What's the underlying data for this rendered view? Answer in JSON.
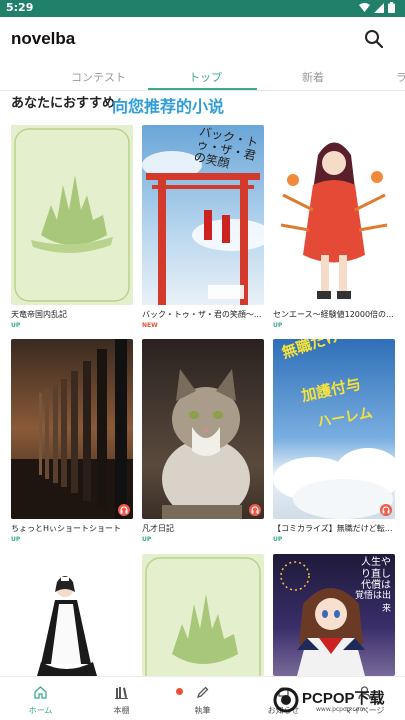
{
  "status_bar": {
    "time": "5:29"
  },
  "app_bar": {
    "title": "novelba"
  },
  "tabs": [
    {
      "label": "コンテスト"
    },
    {
      "label": "トップ"
    },
    {
      "label": "新着"
    },
    {
      "label": "ラ"
    }
  ],
  "section": {
    "title": "あなたにおすすめ",
    "overlay": "向您推荐的小说"
  },
  "books": [
    {
      "title": "天竜帝国内乱記",
      "badge": "UP"
    },
    {
      "title": "バック・トゥ・ザ・君の笑顔～...",
      "badge": "NEW"
    },
    {
      "title": "センエース～経験値12000倍の...",
      "badge": "UP"
    },
    {
      "title": "ちょっとHぃショートショート",
      "badge": "UP"
    },
    {
      "title": "凡才日記",
      "badge": "UP"
    },
    {
      "title": "【コミカライズ】無職だけど転...",
      "badge": "UP"
    }
  ],
  "covers": {
    "book2_text": "バック・トゥ・ザ・君の笑顔",
    "book6_text_1": "無職だけど",
    "book6_text_2": "加護付与",
    "book6_text_3": "ハーレム",
    "book9_text": "人生やり直し代償は",
    "book9_text_2": "覚悟は出来"
  },
  "bottom_nav": [
    {
      "label": "ホーム",
      "icon": "home-icon"
    },
    {
      "label": "本棚",
      "icon": "bookshelf-icon"
    },
    {
      "label": "執筆",
      "icon": "pencil-icon"
    },
    {
      "label": "お知らせ",
      "icon": "bell-icon"
    },
    {
      "label": "マイページ",
      "icon": "person-icon"
    }
  ],
  "watermark": {
    "text": "PCPOP下载",
    "url_text": "www.pcpop.com"
  },
  "colors": {
    "accent": "#3aaa8d",
    "status_bar": "#21806a",
    "new_badge": "#e8503a",
    "overlay_text": "#2f9ed8"
  }
}
